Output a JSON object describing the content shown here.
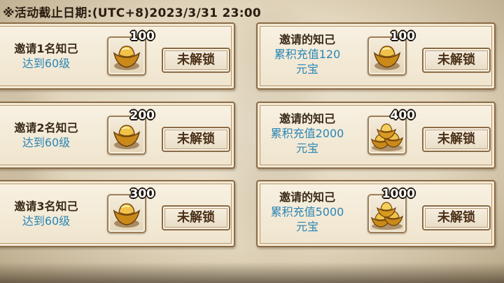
{
  "deadline": "※活动截止日期:(UTC+8)2023/3/31 23:00",
  "left_cards": [
    {
      "line1": "邀请1名知己",
      "line2": "达到60级",
      "amount": "100",
      "icon": "gold-ingot-single",
      "button": "未解锁"
    },
    {
      "line1": "邀请2名知己",
      "line2": "达到60级",
      "amount": "200",
      "icon": "gold-ingot-single",
      "button": "未解锁"
    },
    {
      "line1": "邀请3名知己",
      "line2": "达到60级",
      "amount": "300",
      "icon": "gold-ingot-single",
      "button": "未解锁"
    }
  ],
  "right_cards": [
    {
      "line1": "邀请的知己",
      "line2": "累积充值120",
      "line3": "元宝",
      "amount": "100",
      "icon": "gold-ingot-single",
      "button": "未解锁"
    },
    {
      "line1": "邀请的知己",
      "line2": "累积充值2000",
      "line3": "元宝",
      "amount": "400",
      "icon": "gold-ingot-pile",
      "button": "未解锁"
    },
    {
      "line1": "邀请的知己",
      "line2": "累积充值5000",
      "line3": "元宝",
      "amount": "1000",
      "icon": "gold-ingot-pile",
      "button": "未解锁"
    }
  ],
  "colors": {
    "title_text": "#3a2a18",
    "condition_text": "#2a86b5",
    "button_text": "#4b3018"
  }
}
